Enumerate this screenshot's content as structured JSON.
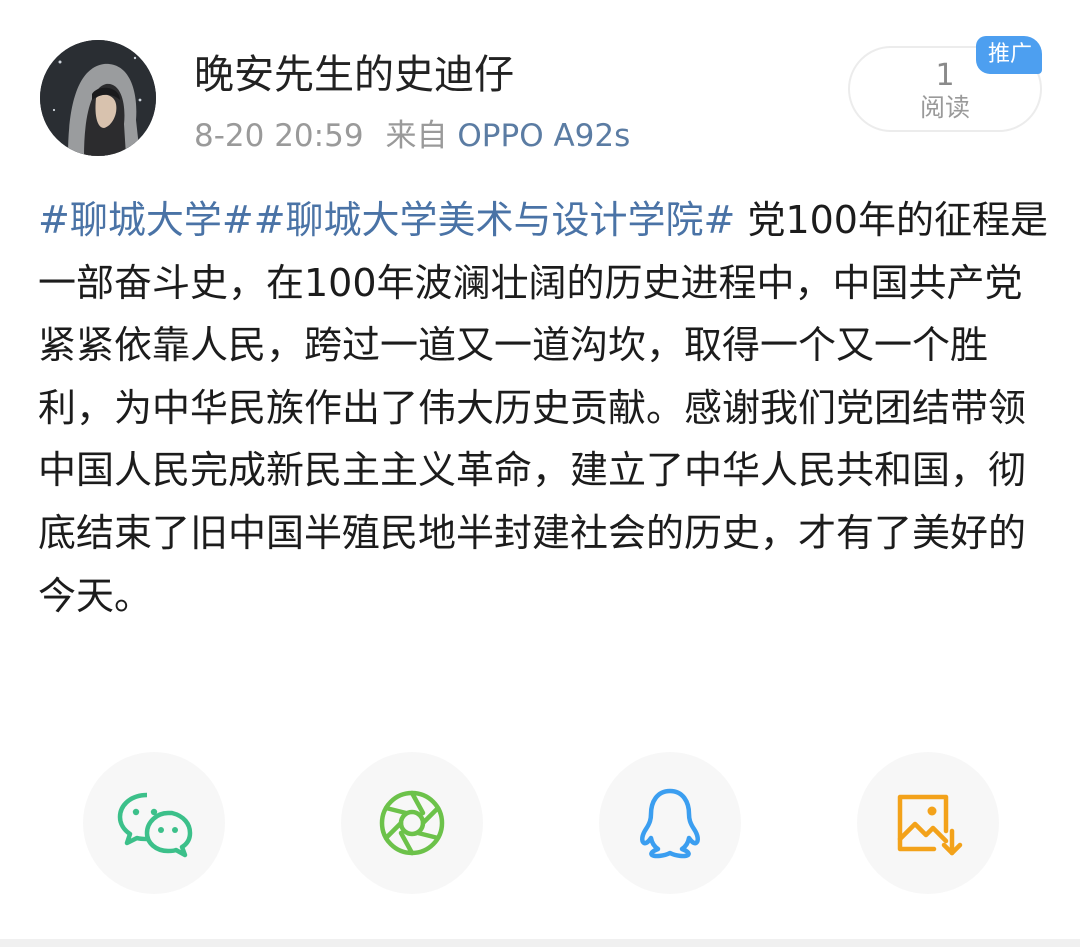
{
  "header": {
    "username": "晚安先生的史迪仔",
    "date": "8-20 20:59",
    "source_prefix": "来自",
    "device": "OPPO A92s",
    "avatar_icon": "avatar-hooded-person"
  },
  "read_stats": {
    "count": "1",
    "label": "阅读",
    "promo_badge": "推广"
  },
  "post": {
    "tag_1": "#聊城大学#",
    "tag_2": "#聊城大学美术与设计学院#",
    "body": " 党100年的征程是一部奋斗史，在100年波澜壮阔的历史进程中，中国共产党紧紧依靠人民，跨过一道又一道沟坎，取得一个又一个胜利，为中华民族作出了伟大历史贡献。感谢我们党团结带领中国人民完成新民主主义革命，建立了中华人民共和国，彻底结束了旧中国半殖民地半封建社会的历史，才有了美好的今天。"
  },
  "share": {
    "buttons": [
      {
        "icon": "wechat-icon",
        "color": "#3cc08a"
      },
      {
        "icon": "moments-icon",
        "color": "#6cc24a"
      },
      {
        "icon": "qq-icon",
        "color": "#3b9ef0"
      },
      {
        "icon": "save-image-icon",
        "color": "#f3a21a"
      }
    ]
  },
  "colors": {
    "link": "#4a73a6",
    "badge": "#4d9ff0",
    "meta_text": "#9a9a9a"
  }
}
